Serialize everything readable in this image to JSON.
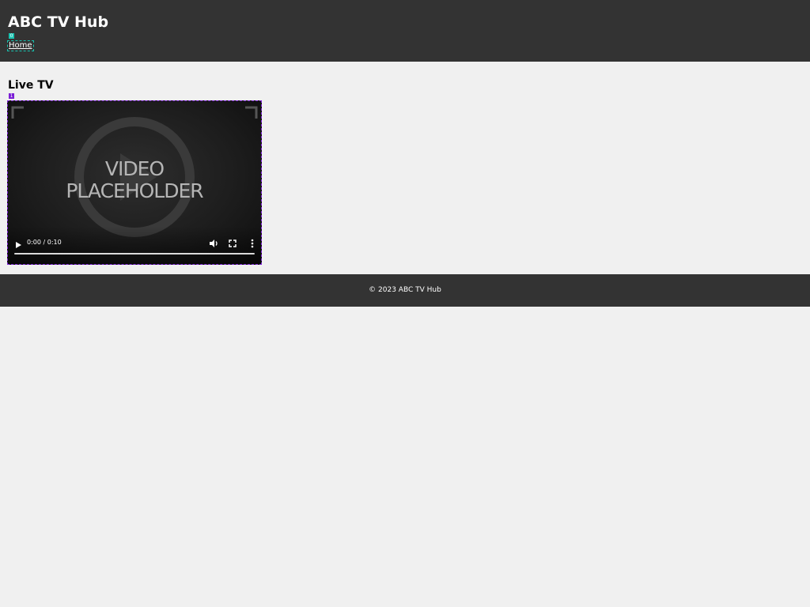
{
  "header": {
    "title": "ABC TV Hub",
    "nav": {
      "home_label": "Home",
      "home_badge": "0"
    }
  },
  "main": {
    "section_title": "Live TV",
    "video": {
      "badge": "1",
      "placeholder_line1": "VIDEO",
      "placeholder_line2": "PLACEHOLDER",
      "time_display": "0:00 / 0:10",
      "progress": 0,
      "icons": [
        "play-icon",
        "volume-icon",
        "fullscreen-icon",
        "more-options-icon"
      ]
    }
  },
  "footer": {
    "text": "© 2023 ABC TV Hub"
  },
  "colors": {
    "header_bg": "#333333",
    "page_bg": "#f0f0f0",
    "nav_highlight": "#19c2b0",
    "video_highlight": "#7b1fd6"
  }
}
